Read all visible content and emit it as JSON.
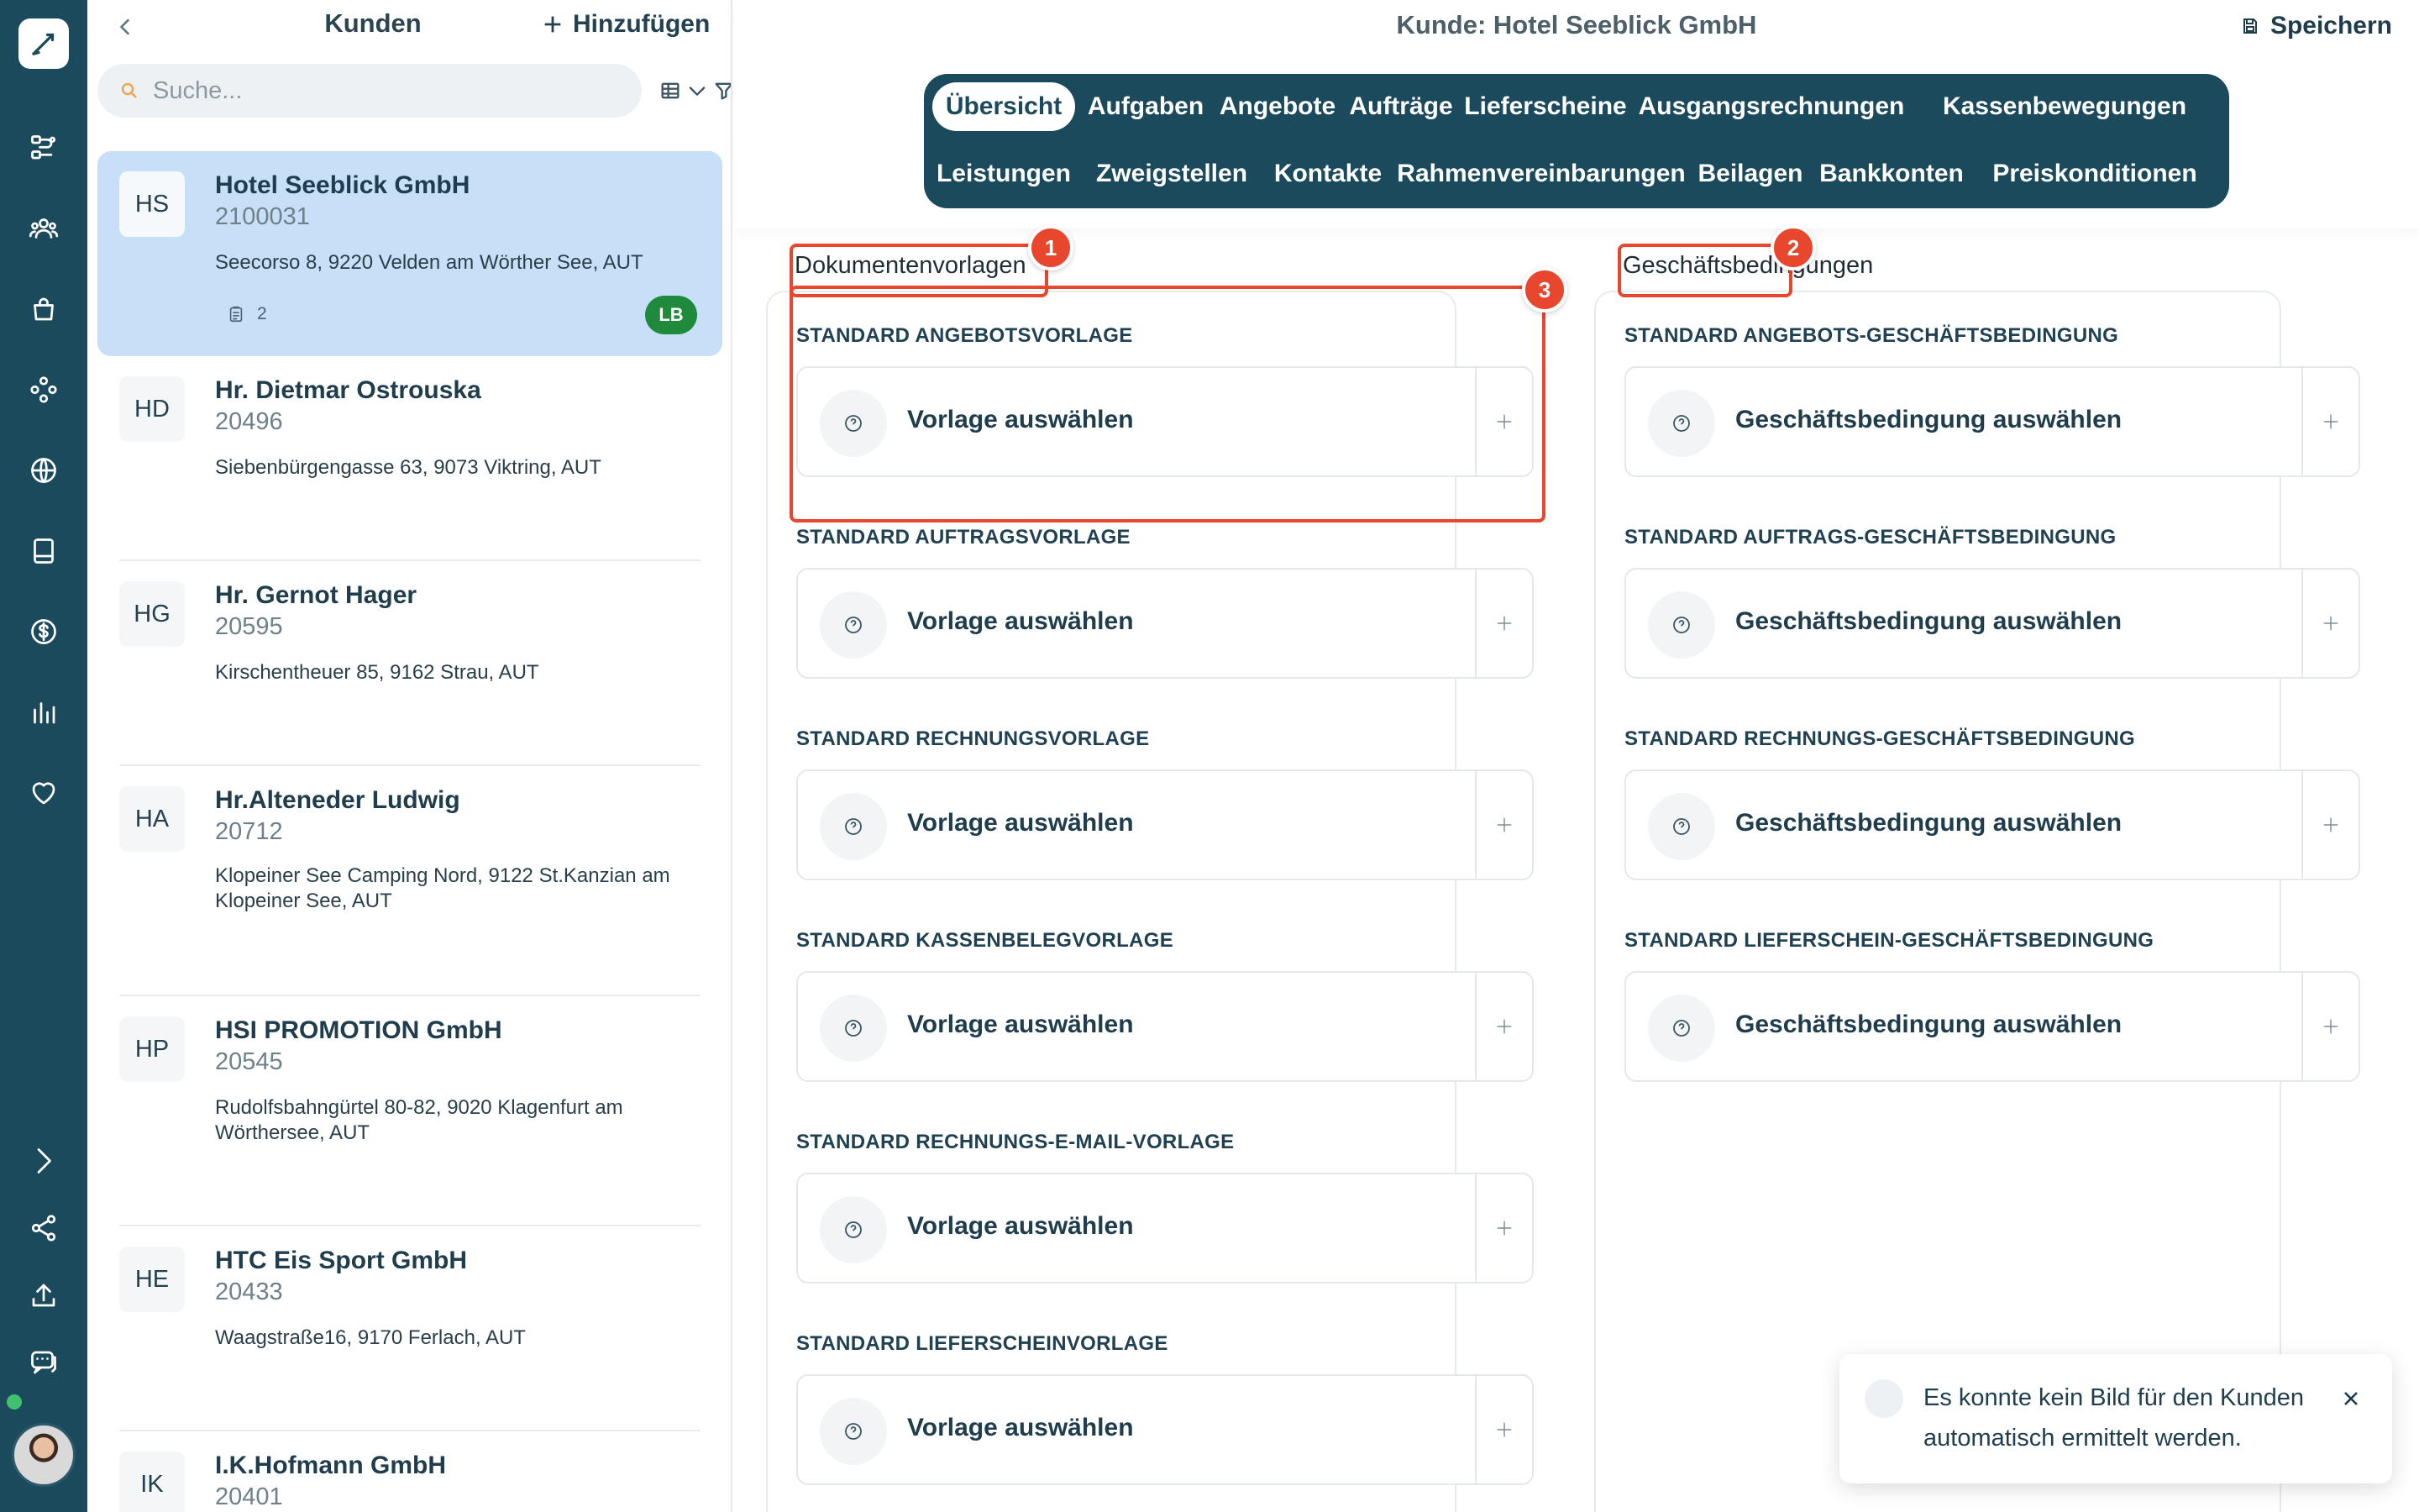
{
  "window": {
    "page_title": "Kunde: Hotel Seeblick GmbH",
    "save_label": "Speichern"
  },
  "sidebar": {
    "icons": [
      "pen-logo-icon",
      "workflow-icon",
      "users-icon",
      "bag-icon",
      "modules-icon",
      "globe-icon",
      "document-icon",
      "dollar-icon",
      "chart-icon",
      "heart-icon",
      "expand-icon",
      "share-icon",
      "upload-icon",
      "chat-icon"
    ],
    "status_color": "#41c06d"
  },
  "customers_panel": {
    "title": "Kunden",
    "add_label": "Hinzufügen",
    "search_placeholder": "Suche...",
    "items": [
      {
        "initials": "HS",
        "name": "Hotel Seeblick GmbH",
        "number": "2100031",
        "address": "Seecorso 8, 9220 Velden am Wörther See, AUT",
        "doc_count": "2",
        "badge": "LB",
        "active": true
      },
      {
        "initials": "HD",
        "name": "Hr. Dietmar Ostrouska",
        "number": "20496",
        "address": "Siebenbürgengasse 63, 9073 Viktring, AUT"
      },
      {
        "initials": "HG",
        "name": "Hr. Gernot Hager",
        "number": "20595",
        "address": "Kirschentheuer 85, 9162 Strau, AUT"
      },
      {
        "initials": "HA",
        "name": "Hr.Alteneder Ludwig",
        "number": "20712",
        "address": "Klopeiner See Camping Nord, 9122 St.Kanzian am Klopeiner See, AUT"
      },
      {
        "initials": "HP",
        "name": "HSI PROMOTION GmbH",
        "number": "20545",
        "address": "Rudolfsbahngürtel 80-82, 9020 Klagenfurt am Wörthersee, AUT"
      },
      {
        "initials": "HE",
        "name": "HTC Eis Sport GmbH",
        "number": "20433",
        "address": "Waagstraße16, 9170 Ferlach, AUT"
      },
      {
        "initials": "IK",
        "name": "I.K.Hofmann GmbH",
        "number": "20401",
        "address": ""
      }
    ]
  },
  "tabs": {
    "row1": [
      "Übersicht",
      "Aufgaben",
      "Angebote",
      "Aufträge",
      "Lieferscheine",
      "Ausgangsrechnungen",
      "Kassenbewegungen"
    ],
    "row2": [
      "Leistungen",
      "Zweigstellen",
      "Kontakte",
      "Rahmenvereinbarungen",
      "Beilagen",
      "Bankkonten",
      "Preiskonditionen"
    ],
    "active": "Übersicht"
  },
  "document_templates": {
    "title": "Dokumentenvorlagen",
    "picker_label": "Vorlage auswählen",
    "sections": [
      "STANDARD ANGEBOTSVORLAGE",
      "STANDARD AUFTRAGSVORLAGE",
      "STANDARD RECHNUNGSVORLAGE",
      "STANDARD KASSENBELEGVORLAGE",
      "STANDARD RECHNUNGS-E-MAIL-VORLAGE",
      "STANDARD LIEFERSCHEINVORLAGE"
    ]
  },
  "business_terms": {
    "title": "Geschäftsbedingungen",
    "picker_label": "Geschäftsbedingung auswählen",
    "sections": [
      "STANDARD ANGEBOTS-GESCHÄFTSBEDINGUNG",
      "STANDARD AUFTRAGS-GESCHÄFTSBEDINGUNG",
      "STANDARD RECHNUNGS-GESCHÄFTSBEDINGUNG",
      "STANDARD LIEFERSCHEIN-GESCHÄFTSBEDINGUNG"
    ]
  },
  "annotations": {
    "markers": [
      "1",
      "2",
      "3"
    ],
    "color": "#e8462d"
  },
  "toast": {
    "message": "Es konnte kein Bild für den Kunden automatisch ermittelt werden."
  },
  "colors": {
    "brand": "#1b4a5c",
    "active_row": "#c8e0f7",
    "badge": "#1f8a3c"
  }
}
